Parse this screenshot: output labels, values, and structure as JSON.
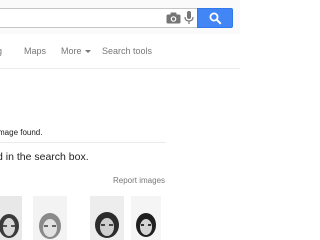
{
  "search": {
    "value": "",
    "icons": [
      "camera-icon",
      "microphone-icon",
      "magnifier-icon"
    ]
  },
  "tabs": [
    {
      "label": "g",
      "name": "Images"
    },
    {
      "label": "Maps"
    },
    {
      "label": "More"
    },
    {
      "label": "Search tools"
    }
  ],
  "results": {
    "no_match_text": "mage found.",
    "hint_text": "d in the search box.",
    "report_link": "Report images"
  },
  "colors": {
    "accent": "#4285f4",
    "tab_text": "#777777",
    "body_text": "#222222"
  }
}
